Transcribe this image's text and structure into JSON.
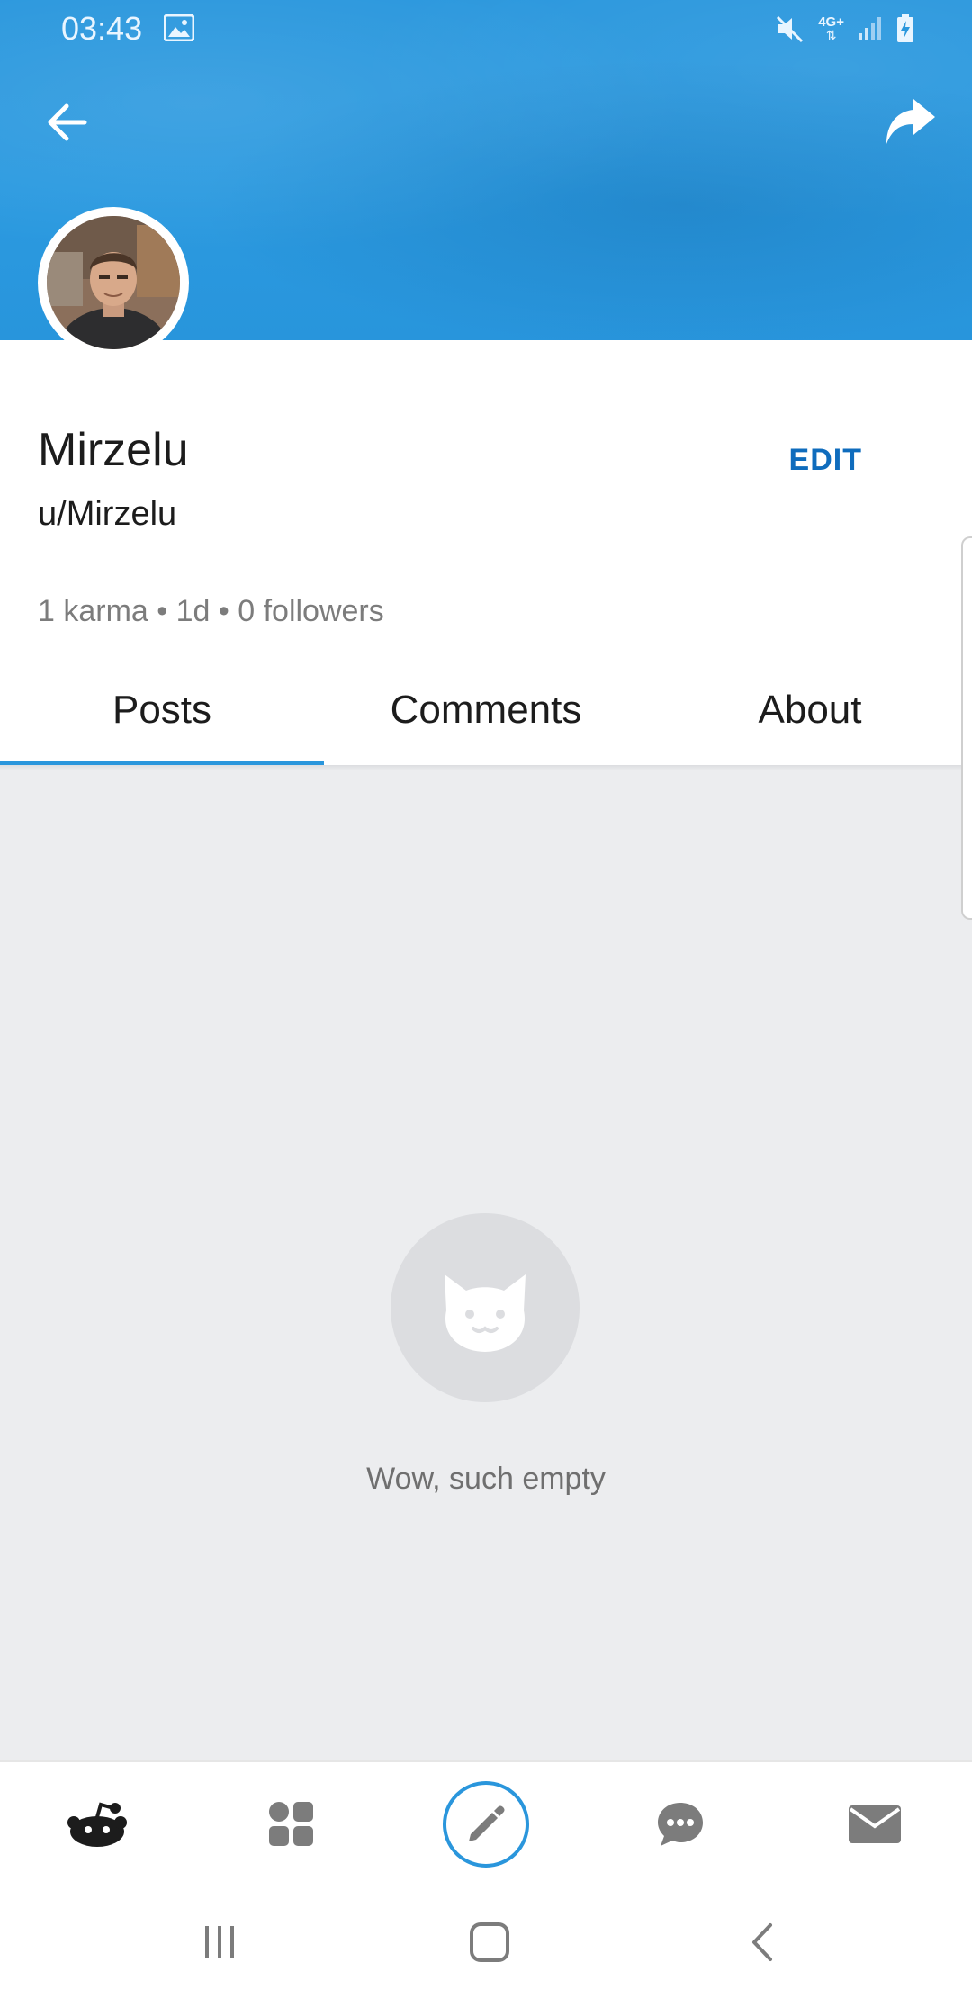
{
  "status_bar": {
    "time": "03:43",
    "network": "4G+",
    "icons": [
      "gallery-icon",
      "mute-icon",
      "signal-icon",
      "battery-charging-icon"
    ]
  },
  "header": {
    "back_icon": "arrow-left-icon",
    "share_icon": "share-arrow-icon",
    "banner_color": "#2a97dd"
  },
  "profile": {
    "display_name": "Mirzelu",
    "username": "u/Mirzelu",
    "edit_label": "EDIT",
    "stats": "1 karma • 1d • 0 followers"
  },
  "tabs": [
    {
      "label": "Posts",
      "active": true
    },
    {
      "label": "Comments",
      "active": false
    },
    {
      "label": "About",
      "active": false
    }
  ],
  "empty_state": {
    "icon": "cat-face-icon",
    "message": "Wow, such empty"
  },
  "bottom_nav": [
    {
      "name": "home",
      "icon": "reddit-snoo-icon"
    },
    {
      "name": "communities",
      "icon": "grid-shapes-icon"
    },
    {
      "name": "create",
      "icon": "pencil-icon"
    },
    {
      "name": "chat",
      "icon": "chat-bubble-icon"
    },
    {
      "name": "inbox",
      "icon": "envelope-icon"
    }
  ],
  "colors": {
    "accent": "#2a96dc",
    "edit_blue": "#0f6cbd",
    "content_bg": "#ecedef"
  }
}
